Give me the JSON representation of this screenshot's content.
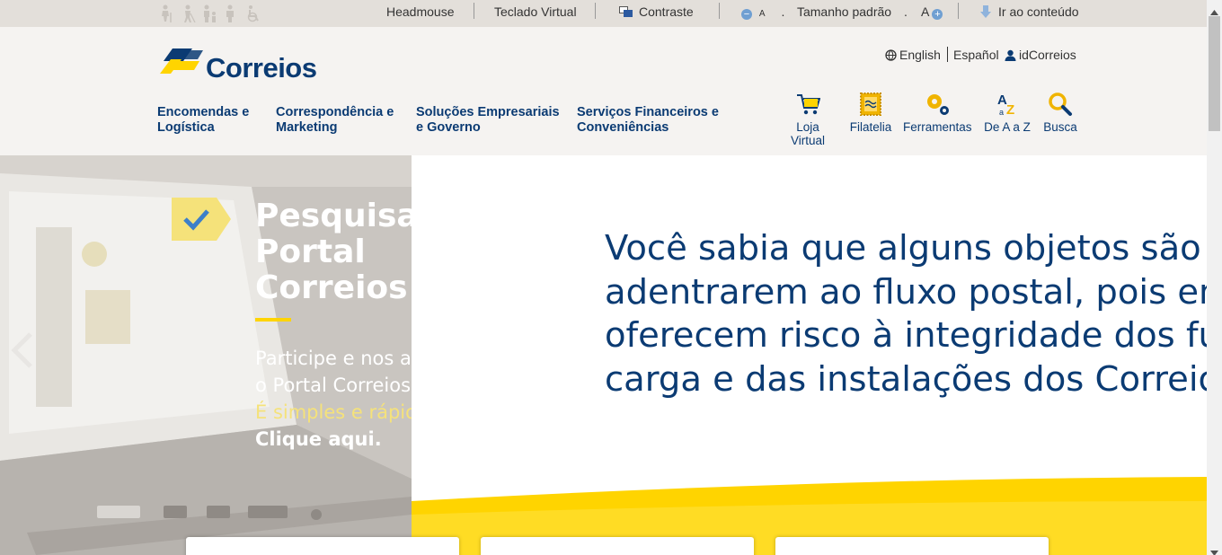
{
  "accessibility_bar": {
    "headmouse": "Headmouse",
    "teclado_virtual": "Teclado Virtual",
    "contraste": "Contraste",
    "font_decrease": "A",
    "font_size": "Tamanho padrão",
    "font_increase": "A",
    "skip_link": "Ir ao conteúdo"
  },
  "header": {
    "logo_text": "Correios",
    "languages": {
      "english": "English",
      "espanol": "Español",
      "id": "idCorreios"
    },
    "nav": [
      {
        "line1": "Encomendas e",
        "line2": "Logística"
      },
      {
        "line1": "Correspondência e",
        "line2": "Marketing"
      },
      {
        "line1": "Soluções Empresariais",
        "line2": "e Governo"
      },
      {
        "line1": "Serviços Financeiros e",
        "line2": "Conveniências"
      }
    ],
    "tools": [
      {
        "label": "Loja Virtual",
        "icon": "cart-icon"
      },
      {
        "label": "Filatelia",
        "icon": "stamp-icon"
      },
      {
        "label": "Ferramentas",
        "icon": "gears-icon"
      },
      {
        "label": "De A a Z",
        "icon": "az-icon"
      },
      {
        "label": "Busca",
        "icon": "search-icon"
      }
    ]
  },
  "hero": {
    "title_lines": [
      "Pesquisa",
      "Portal",
      "Correios"
    ],
    "body_line1": "Participe e nos a",
    "body_line2": "o Portal Correios",
    "body_highlight": "É simples e rápio",
    "cta": "Clique aqui.",
    "right_lines": [
      "Você sabia que alguns objetos são",
      "adentrarem ao fluxo postal, pois em",
      "oferecem risco à integridade dos fun",
      "carga e das instalações dos Correios?"
    ]
  },
  "colors": {
    "brand_blue": "#0b3b73",
    "brand_yellow": "#ffd400",
    "topbar_bg": "#e3dfda",
    "header_bg": "#f5f3f1"
  }
}
